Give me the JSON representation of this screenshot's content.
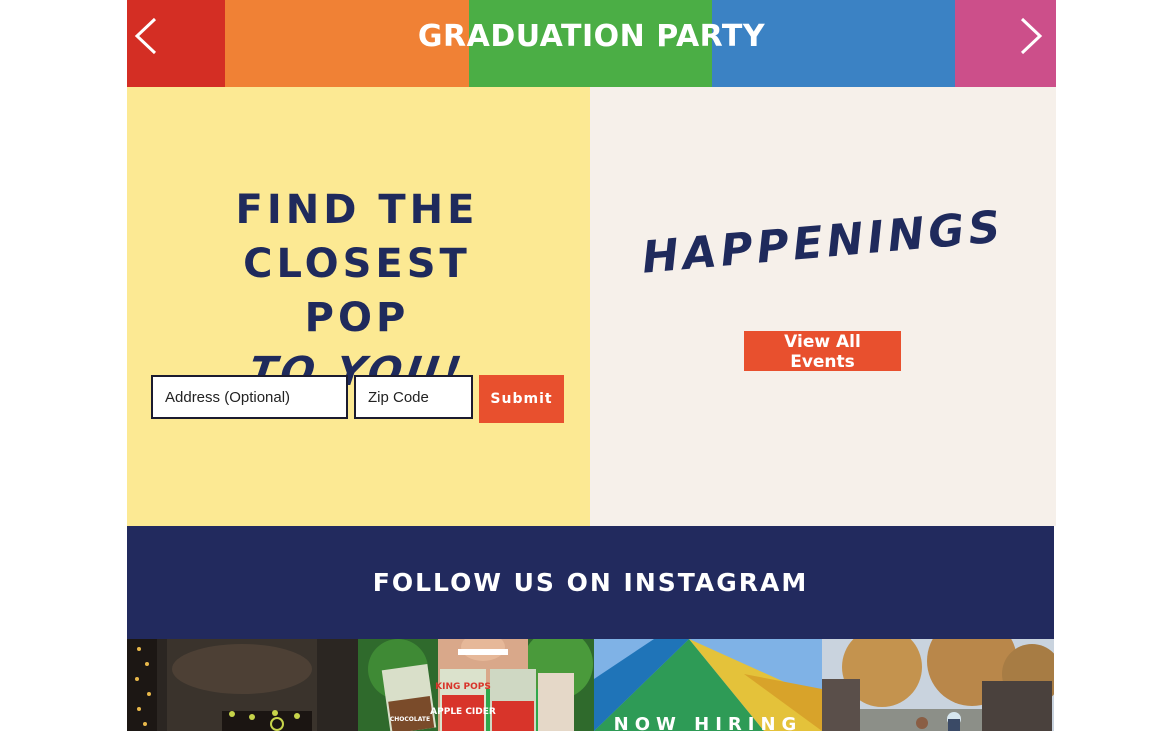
{
  "banner": {
    "title": "GRADUATION PARTY",
    "stripes": [
      {
        "color": "#d42e24",
        "width": 98
      },
      {
        "color": "#f08135",
        "width": 244
      },
      {
        "color": "#4bae45",
        "width": 243
      },
      {
        "color": "#3b82c4",
        "width": 243
      },
      {
        "color": "#cc4f8a",
        "width": 101
      }
    ],
    "prev_icon": "chevron-left-icon",
    "next_icon": "chevron-right-icon"
  },
  "finder": {
    "title_line1": "FIND THE",
    "title_line2": "CLOSEST POP",
    "title_line3": "TO YOU!",
    "address_placeholder": "Address (Optional)",
    "zip_placeholder": "Zip Code",
    "submit_label": "Submit",
    "bg_color": "#fce993"
  },
  "happenings": {
    "title": "HAPPENINGS",
    "button_label": "View All Events",
    "bg_color": "#f6f0ea"
  },
  "instagram": {
    "title": "FOLLOW US ON INSTAGRAM",
    "bg_color": "#222a5e",
    "photo3_overlay": "NOW HIRING",
    "photo2_labels": [
      "KING POPS",
      "APPLE CIDER",
      "CHOCOLATE"
    ]
  },
  "colors": {
    "accent": "#e8502e",
    "navy_text": "#1f2a5c"
  }
}
